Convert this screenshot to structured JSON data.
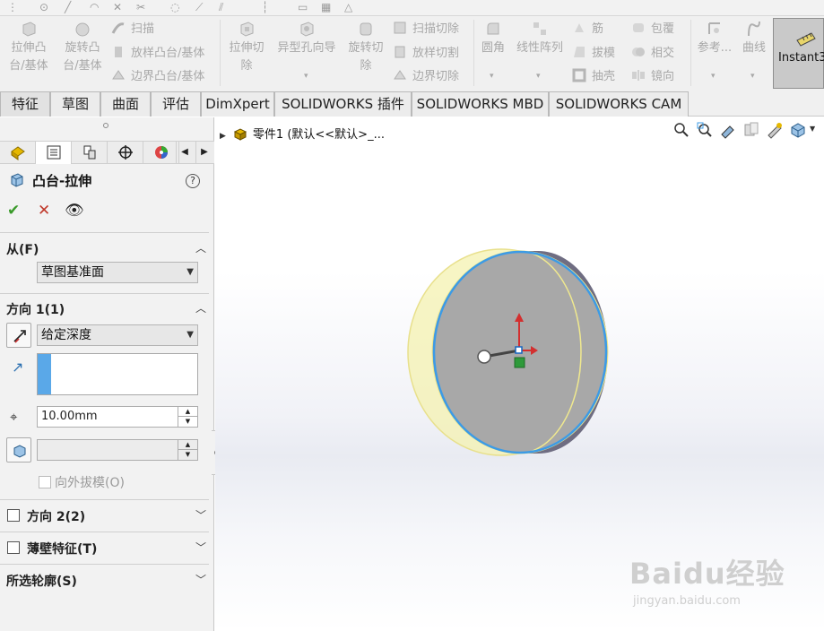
{
  "ribbon": {
    "extrude_boss": "拉伸凸\n台/基体",
    "revolve_boss": "旋转凸\n台/基体",
    "sweep": "扫描",
    "loft_boss": "放样凸台/基体",
    "boundary_boss": "边界凸台/基体",
    "extrude_cut": "拉伸切\n除",
    "hole_wizard": "异型孔向导",
    "revolve_cut": "旋转切\n除",
    "sweep_cut": "扫描切除",
    "loft_cut": "放样切割",
    "boundary_cut": "边界切除",
    "fillet": "圆角",
    "linear_pattern": "线性阵列",
    "rib": "筋",
    "draft": "拔模",
    "shell": "抽壳",
    "wrap": "包覆",
    "intersect": "相交",
    "mirror": "镜向",
    "reference": "参考...",
    "curves": "曲线",
    "instant3d": "Instant3"
  },
  "tabs": [
    "特征",
    "草图",
    "曲面",
    "评估",
    "DimXpert",
    "SOLIDWORKS 插件",
    "SOLIDWORKS MBD",
    "SOLIDWORKS CAM"
  ],
  "pm": {
    "title": "凸台-拉伸",
    "from_label": "从(F)",
    "from_value": "草图基准面",
    "dir1_label": "方向 1(1)",
    "dir1_type": "给定深度",
    "depth": "10.00mm",
    "draft_outward": "向外拔模(O)",
    "dir2_label": "方向 2(2)",
    "thin_label": "薄壁特征(T)",
    "contours_label": "所选轮廓(S)"
  },
  "viewport": {
    "tree_path": "零件1  (默认<<默认>_..."
  },
  "watermark": {
    "main": "Baidu经验",
    "sub": "jingyan.baidu.com"
  },
  "colors": {
    "accent": "#3c9be6",
    "model_face": "#a8a8a8",
    "preview": "#f4f1b0"
  }
}
